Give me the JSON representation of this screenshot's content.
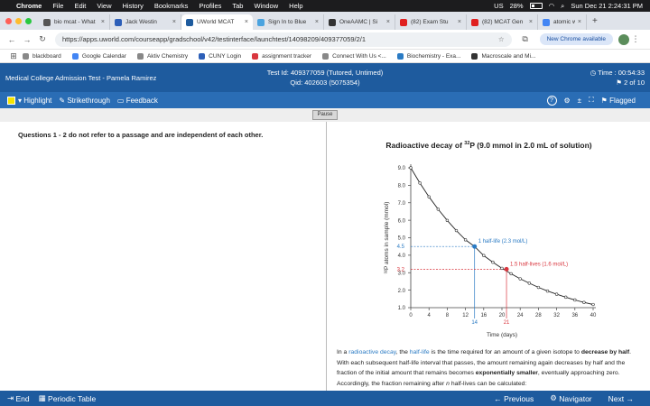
{
  "menubar": {
    "app": "Chrome",
    "items": [
      "File",
      "Edit",
      "View",
      "History",
      "Bookmarks",
      "Profiles",
      "Tab",
      "Window",
      "Help"
    ],
    "battery": "28%",
    "lang": "US",
    "clock": "Sun Dec 21  2:24:31 PM"
  },
  "tabs": [
    {
      "label": "bio mcat - What",
      "color": "#555555"
    },
    {
      "label": "Jack Westin",
      "color": "#2d5fb8"
    },
    {
      "label": "UWorld MCAT",
      "color": "#1e5b9e"
    },
    {
      "label": "Sign In to Blue",
      "color": "#4aa3df"
    },
    {
      "label": "OneAAMC | Si",
      "color": "#333333"
    },
    {
      "label": "(82) Exam Stu",
      "color": "#e02020"
    },
    {
      "label": "(82) MCAT Gen",
      "color": "#e02020"
    },
    {
      "label": "atomic weight",
      "color": "#4285f4"
    }
  ],
  "address": {
    "url": "https://apps.uworld.com/courseapp/gradschool/v42/testinterface/launchtest/14098209/409377059/2/1",
    "chrome_available": "New Chrome available"
  },
  "bookmarks": [
    "blackboard",
    "Google Calendar",
    "Aktiv Chemistry",
    "CUNY Login",
    "assignment tracker",
    "Connect With Us <...",
    "Biochemistry - Exa...",
    "Macroscale and Mi..."
  ],
  "header": {
    "title": "Medical College Admission Test - Pamela Ramirez",
    "test_id": "Test Id: 409377059  (Tutored, Untimed)",
    "qid": "Qid: 402603 (5075354)",
    "time": "Time : 00:54:33",
    "progress": "2 of 10"
  },
  "toolbar": {
    "highlight": "Highlight",
    "strikethrough": "Strikethrough",
    "feedback": "Feedback",
    "flagged": "Flagged"
  },
  "pause": "Pause",
  "passage": {
    "instruction": "Questions 1 - 2 do not refer to a passage and are independent of each other."
  },
  "chart_data": {
    "type": "line",
    "title_pre": "Radioactive decay of ",
    "title_sup": "32",
    "title_post": "P (9.0 mmol in 2.0 mL of solution)",
    "xlabel": "Time (days)",
    "ylabel": "³²P atoms in sample (mmol)",
    "xlim": [
      0,
      40
    ],
    "ylim": [
      1.0,
      9.0
    ],
    "xticks": [
      0,
      4,
      8,
      12,
      16,
      20,
      24,
      28,
      32,
      36,
      40
    ],
    "yticks": [
      1.0,
      2.0,
      3.0,
      4.0,
      5.0,
      6.0,
      7.0,
      8.0,
      9.0
    ],
    "series": [
      {
        "x": [
          0,
          2,
          4,
          6,
          8,
          10,
          12,
          14,
          16,
          18,
          20,
          22,
          24,
          26,
          28,
          30,
          32,
          34,
          36,
          38,
          40
        ],
        "y": [
          9.0,
          8.13,
          7.34,
          6.63,
          5.99,
          5.41,
          4.88,
          4.5,
          3.98,
          3.6,
          3.25,
          2.94,
          2.65,
          2.4,
          2.16,
          1.95,
          1.77,
          1.6,
          1.44,
          1.3,
          1.18
        ]
      }
    ],
    "markers": [
      {
        "x": 14,
        "y": 4.5,
        "x_label": "14",
        "y_label": "4.5",
        "text": "1 half-life (2.3 mol/L)",
        "color": "#2b7bc4"
      },
      {
        "x": 21,
        "y": 3.2,
        "x_label": "21",
        "y_label": "3.2",
        "text": "1.5 half-lives (1.6 mol/L)",
        "color": "#d9363e"
      }
    ]
  },
  "explanation": {
    "p1": "In a ",
    "link1": "radioactive decay",
    "p2": ", the ",
    "link2": "half-life",
    "p3": " is the time required for an amount of a given isotope to ",
    "b1": "decrease by half",
    "p4": ".  With each subsequent half-life interval that passes, the amount remaining again decreases by half and the fraction of the initial amount that remains becomes ",
    "b2": "exponentially smaller",
    "p5": ", eventually approaching zero.  Accordingly, the fraction remaining after ",
    "i1": "n",
    "p6": " half-lives can be calculated:"
  },
  "bottom": {
    "end": "End",
    "periodic": "Periodic Table",
    "previous": "Previous",
    "navigator": "Navigator",
    "next": "Next"
  }
}
